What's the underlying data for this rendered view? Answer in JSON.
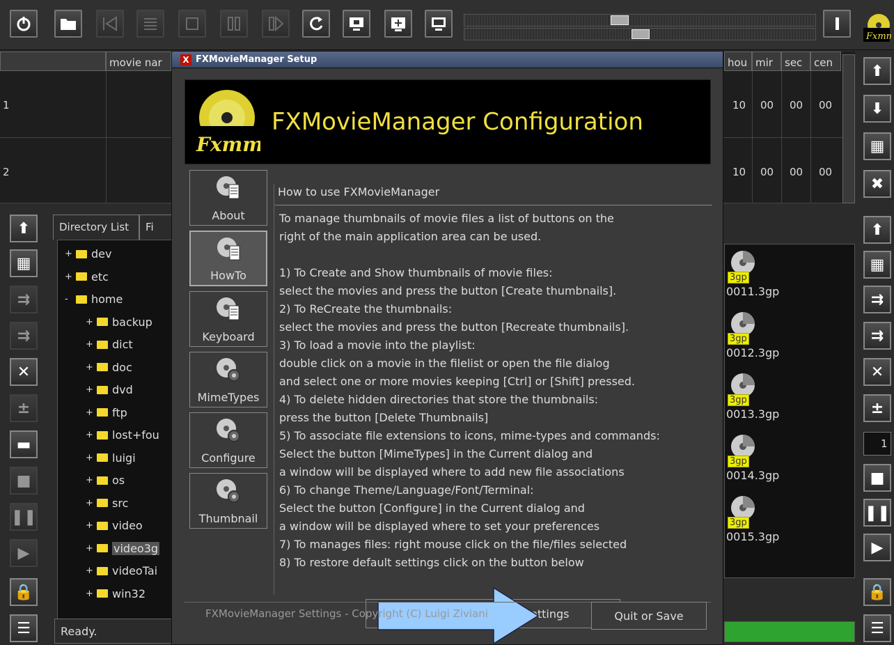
{
  "toolbar": {
    "icons": [
      "power-icon",
      "folder-icon",
      "first-icon",
      "list-icon",
      "stop-icon",
      "pause-icon",
      "next-icon",
      "refresh-icon",
      "screen-icon",
      "fullscreen-icon",
      "monitor-icon"
    ]
  },
  "grid": {
    "headers": [
      "movie nar",
      "hou",
      "mir",
      "sec",
      "cen"
    ],
    "rows": [
      {
        "num": "1",
        "hou": "10",
        "min": "00",
        "sec": "00",
        "cen": "00"
      },
      {
        "num": "2",
        "hou": "10",
        "min": "00",
        "sec": "00",
        "cen": "00"
      }
    ]
  },
  "left_tabs": [
    "Directory List",
    "Fi"
  ],
  "tree": [
    {
      "prefix": "+",
      "label": "dev"
    },
    {
      "prefix": "+",
      "label": "etc"
    },
    {
      "prefix": "-",
      "label": "home"
    },
    {
      "prefix": "+",
      "label": "backup"
    },
    {
      "prefix": "+",
      "label": "dict"
    },
    {
      "prefix": "+",
      "label": "doc"
    },
    {
      "prefix": "+",
      "label": "dvd"
    },
    {
      "prefix": "+",
      "label": "ftp"
    },
    {
      "prefix": "+",
      "label": "lost+fou"
    },
    {
      "prefix": "+",
      "label": "luigi"
    },
    {
      "prefix": "+",
      "label": "os"
    },
    {
      "prefix": "+",
      "label": "src"
    },
    {
      "prefix": "+",
      "label": "video"
    },
    {
      "prefix": "+",
      "label": "video3g"
    },
    {
      "prefix": "+",
      "label": "videoTai"
    },
    {
      "prefix": "+",
      "label": "win32"
    }
  ],
  "files": [
    {
      "tag": "3gp",
      "name": "0011.3gp"
    },
    {
      "tag": "3gp",
      "name": "0012.3gp"
    },
    {
      "tag": "3gp",
      "name": "0013.3gp"
    },
    {
      "tag": "3gp",
      "name": "0014.3gp"
    },
    {
      "tag": "3gp",
      "name": "0015.3gp"
    }
  ],
  "status": "Ready.",
  "spin_value": "1",
  "dialog": {
    "title": "FXMovieManager Setup",
    "close": "X",
    "banner_title": "FXMovieManager Configuration",
    "side_buttons": [
      "About",
      "HowTo",
      "Keyboard",
      "MimeTypes",
      "Configure",
      "Thumbnail"
    ],
    "content_title": "How to use FXMovieManager",
    "lines": [
      "To manage thumbnails of movie files a list of buttons on the",
      "right of the main application area can be used.",
      "",
      "1) To Create and Show thumbnails of movie files:",
      "select the movies and press the button [Create thumbnails].",
      "2) To ReCreate the thumbnails:",
      "select the movies and press the button [Recreate thumbnails].",
      "3) To load a movie into the playlist:",
      "double click on a movie in the filelist or open the file dialog",
      "and select one or more movies keeping [Ctrl] or [Shift] pressed.",
      "4) To delete hidden directories that store the thumbnails:",
      "press the button [Delete Thumbnails]",
      "5) To associate file extensions to icons, mime-types and commands:",
      "Select the button [MimeTypes] in the Current dialog and",
      "a window will be displayed where to add new file associations",
      "6) To change Theme/Language/Font/Terminal:",
      "Select the button  [Configure] in the Current dialog and",
      "a window will be displayed where to set your preferences",
      "7) To manages files: right mouse click on the file/files selected",
      "8) To restore default settings click on the button below"
    ],
    "restore_label": "Restore Default Settings",
    "copyright": "FXMovieManager Settings - Copyright (C) Luigi Ziviani",
    "quit_label": "Quit or Save"
  },
  "colors": {
    "accent_yellow": "#f0e040",
    "arrow_blue": "#99ccff",
    "progress_green": "#2fa32f"
  }
}
